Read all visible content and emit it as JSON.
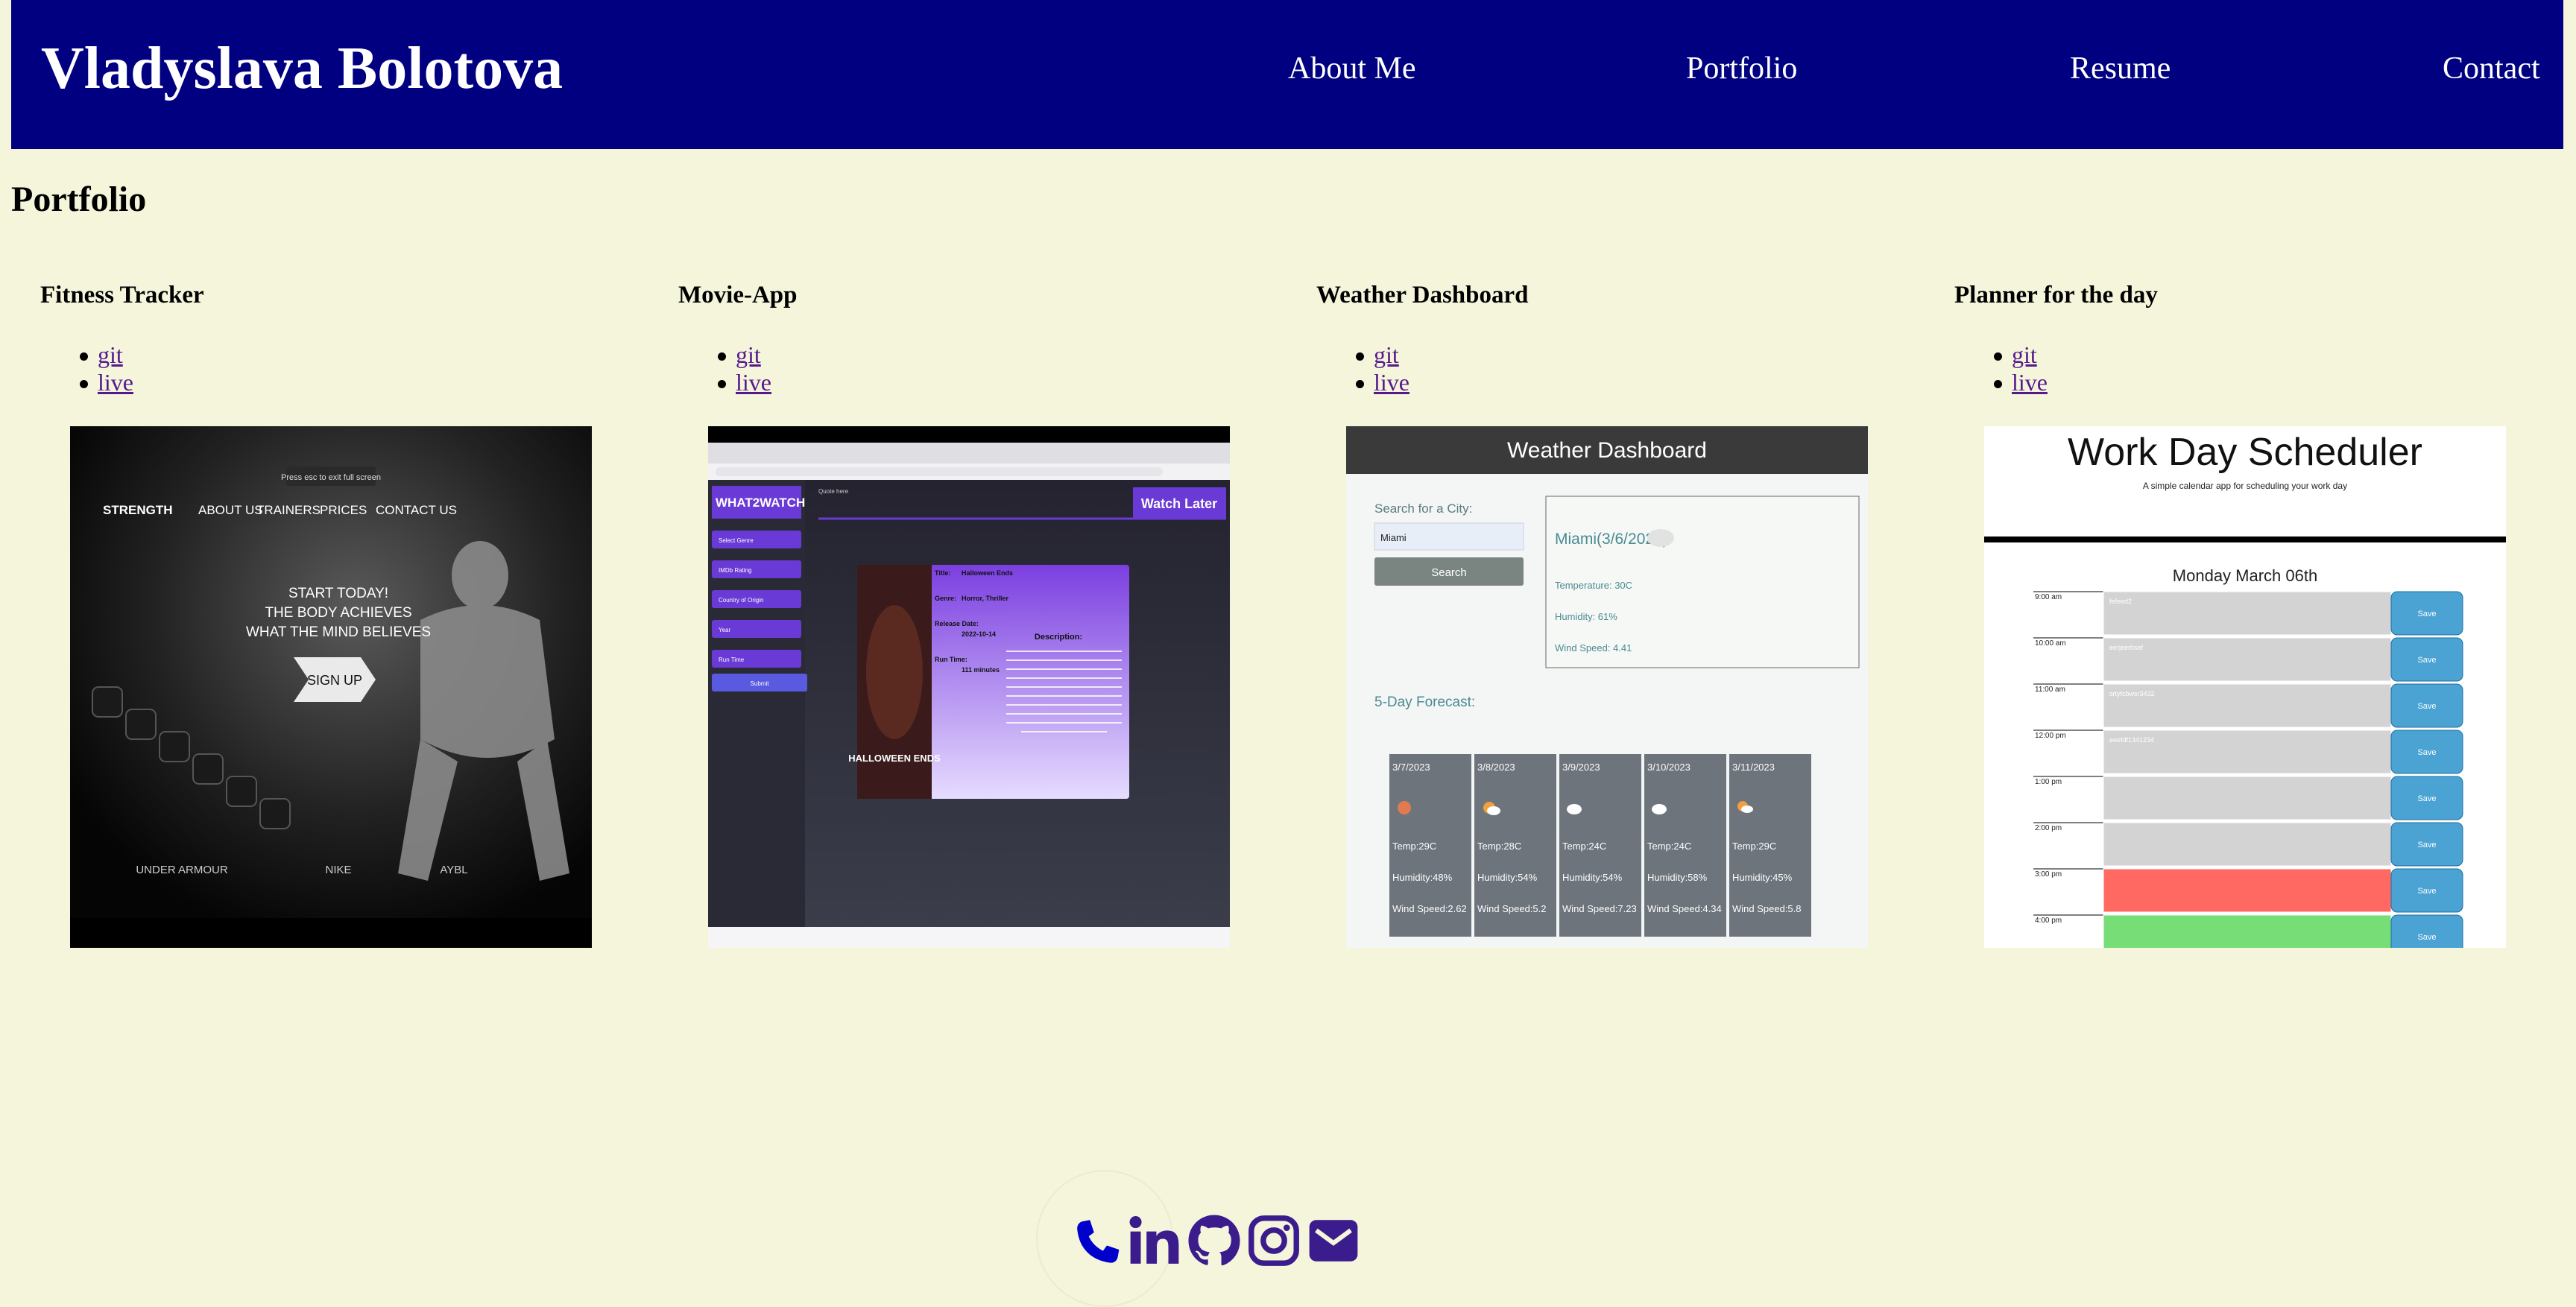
{
  "header": {
    "brand": "Vladyslava Bolotova",
    "nav": [
      "About Me",
      "Portfolio",
      "Resume",
      "Contact"
    ]
  },
  "page": {
    "section_title": "Portfolio"
  },
  "projects": [
    {
      "title": "Fitness Tracker",
      "git_label": "git",
      "live_label": "live",
      "preview": {
        "fullscreen_hint": "Press  esc  to exit full screen",
        "logo": "STRENGTH",
        "menu": [
          "ABOUT US",
          "TRAINERS",
          "PRICES",
          "CONTACT US"
        ],
        "hero": [
          "START TODAY!",
          "THE BODY ACHIEVES",
          "WHAT THE MIND BELIEVES"
        ],
        "cta": "SIGN UP",
        "brands": [
          "UNDER ARMOUR",
          "NIKE",
          "AYBL"
        ]
      }
    },
    {
      "title": "Movie-App",
      "git_label": "git",
      "live_label": "live",
      "preview": {
        "logo": "WHAT2WATCH",
        "quote": "Quote here",
        "watch_later": "Watch Later",
        "filters": [
          "Select Genre",
          "IMDb Rating",
          "Country of Origin",
          "Year",
          "Run Time"
        ],
        "submit": "Submit",
        "poster_title": "HALLOWEEN ENDS",
        "details": [
          {
            "label": "Title:",
            "value": "Halloween Ends"
          },
          {
            "label": "Genre:",
            "value": "Horror, Thriller"
          },
          {
            "label": "Release Date:",
            "value": "2022-10-14"
          },
          {
            "label": "Run Time:",
            "value": "111 minutes"
          }
        ],
        "description_title": "Description:"
      }
    },
    {
      "title": "Weather Dashboard",
      "git_label": "git",
      "live_label": "live",
      "preview": {
        "app_title": "Weather Dashboard",
        "search_label": "Search for a City:",
        "search_value": "Miami",
        "search_button": "Search",
        "current": {
          "city": "Miami(3/6/2023)",
          "temperature": "Temperature: 30C",
          "humidity": "Humidity: 61%",
          "wind": "Wind Speed: 4.41"
        },
        "forecast_title": "5-Day Forecast:",
        "forecast": [
          {
            "date": "3/7/2023",
            "temp": "Temp:29C",
            "humidity": "Humidity:48%",
            "wind": "Wind Speed:2.62"
          },
          {
            "date": "3/8/2023",
            "temp": "Temp:28C",
            "humidity": "Humidity:54%",
            "wind": "Wind Speed:5.2"
          },
          {
            "date": "3/9/2023",
            "temp": "Temp:24C",
            "humidity": "Humidity:54%",
            "wind": "Wind Speed:7.23"
          },
          {
            "date": "3/10/2023",
            "temp": "Temp:24C",
            "humidity": "Humidity:58%",
            "wind": "Wind Speed:4.34"
          },
          {
            "date": "3/11/2023",
            "temp": "Temp:29C",
            "humidity": "Humidity:45%",
            "wind": "Wind Speed:5.8"
          }
        ]
      }
    },
    {
      "title": "Planner for the day",
      "git_label": "git",
      "live_label": "live",
      "preview": {
        "app_title": "Work Day Scheduler",
        "subtitle": "A simple calendar app for scheduling your work day",
        "date": "Monday March 06th",
        "save_label": "Save",
        "hours": [
          {
            "time": "9:00 am",
            "note": "fefeed2",
            "state": "past"
          },
          {
            "time": "10:00 am",
            "note": "eerjeerhsef",
            "state": "past"
          },
          {
            "time": "11:00 am",
            "note": "srtyfcbwsr3432",
            "state": "past"
          },
          {
            "time": "12:00 pm",
            "note": "eeefdf1341234",
            "state": "past"
          },
          {
            "time": "1:00 pm",
            "note": "",
            "state": "past"
          },
          {
            "time": "2:00 pm",
            "note": "",
            "state": "past"
          },
          {
            "time": "3:00 pm",
            "note": "",
            "state": "present"
          },
          {
            "time": "4:00 pm",
            "note": "",
            "state": "future"
          }
        ]
      }
    }
  ],
  "footer": {
    "icons": [
      "phone-icon",
      "linkedin-icon",
      "github-icon",
      "instagram-icon",
      "email-icon"
    ]
  },
  "colors": {
    "page_bg": "#f5f5dc",
    "header_bg": "#000080",
    "link": "#551a8b",
    "phone_icon": "#0000cc",
    "social_icon": "#3b1c8c"
  }
}
